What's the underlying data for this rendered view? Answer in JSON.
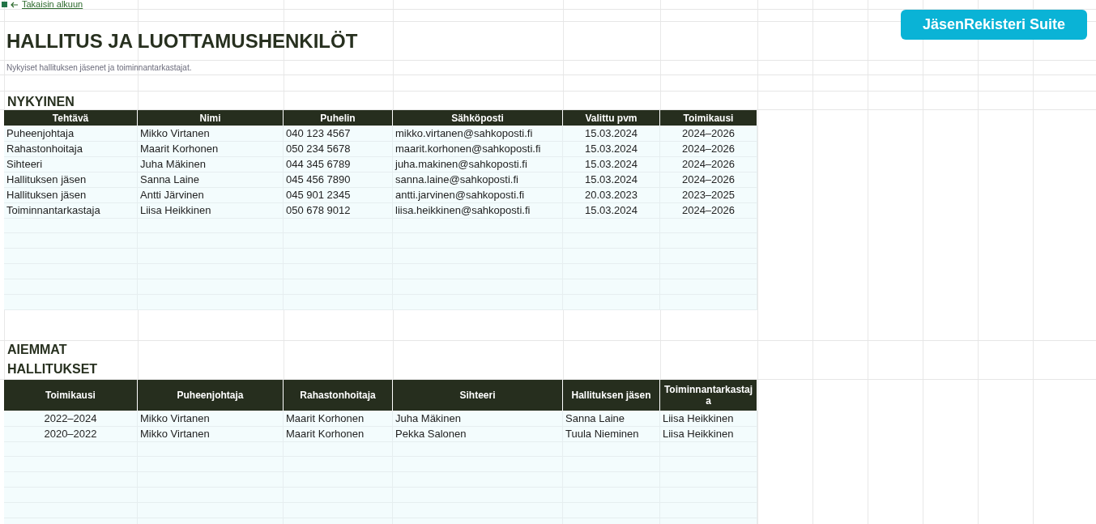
{
  "back_link": "Takaisin alkuun",
  "title": "HALLITUS JA LUOTTAMUSHENKILÖT",
  "subtitle": "Nykyiset hallituksen jäsenet ja toiminnantarkastajat.",
  "brand_button": "JäsenRekisteri Suite",
  "current": {
    "heading": "NYKYINEN",
    "columns": [
      "Tehtävä",
      "Nimi",
      "Puhelin",
      "Sähköposti",
      "Valittu pvm",
      "Toimikausi"
    ],
    "rows": [
      [
        "Puheenjohtaja",
        "Mikko Virtanen",
        "040 123 4567",
        "mikko.virtanen@sahkoposti.fi",
        "15.03.2024",
        "2024–2026"
      ],
      [
        "Rahastonhoitaja",
        "Maarit Korhonen",
        "050 234 5678",
        "maarit.korhonen@sahkoposti.fi",
        "15.03.2024",
        "2024–2026"
      ],
      [
        "Sihteeri",
        "Juha Mäkinen",
        "044 345 6789",
        "juha.makinen@sahkoposti.fi",
        "15.03.2024",
        "2024–2026"
      ],
      [
        "Hallituksen jäsen",
        "Sanna Laine",
        "045 456 7890",
        "sanna.laine@sahkoposti.fi",
        "15.03.2024",
        "2024–2026"
      ],
      [
        "Hallituksen jäsen",
        "Antti Järvinen",
        "045 901 2345",
        "antti.jarvinen@sahkoposti.fi",
        "20.03.2023",
        "2023–2025"
      ],
      [
        "Toiminnantarkastaja",
        "Liisa Heikkinen",
        "050 678 9012",
        "liisa.heikkinen@sahkoposti.fi",
        "15.03.2024",
        "2024–2026"
      ]
    ]
  },
  "past": {
    "heading": "AIEMMAT HALLITUKSET",
    "columns": [
      "Toimikausi",
      "Puheenjohtaja",
      "Rahastonhoitaja",
      "Sihteeri",
      "Hallituksen jäsen",
      "Toiminnantarkastaja"
    ],
    "rows": [
      [
        "2022–2024",
        "Mikko Virtanen",
        "Maarit Korhonen",
        "Juha Mäkinen",
        "Sanna Laine",
        "Liisa Heikkinen"
      ],
      [
        "2020–2022",
        "Mikko Virtanen",
        "Maarit Korhonen",
        "Pekka Salonen",
        "Tuula Nieminen",
        "Liisa Heikkinen"
      ]
    ]
  }
}
